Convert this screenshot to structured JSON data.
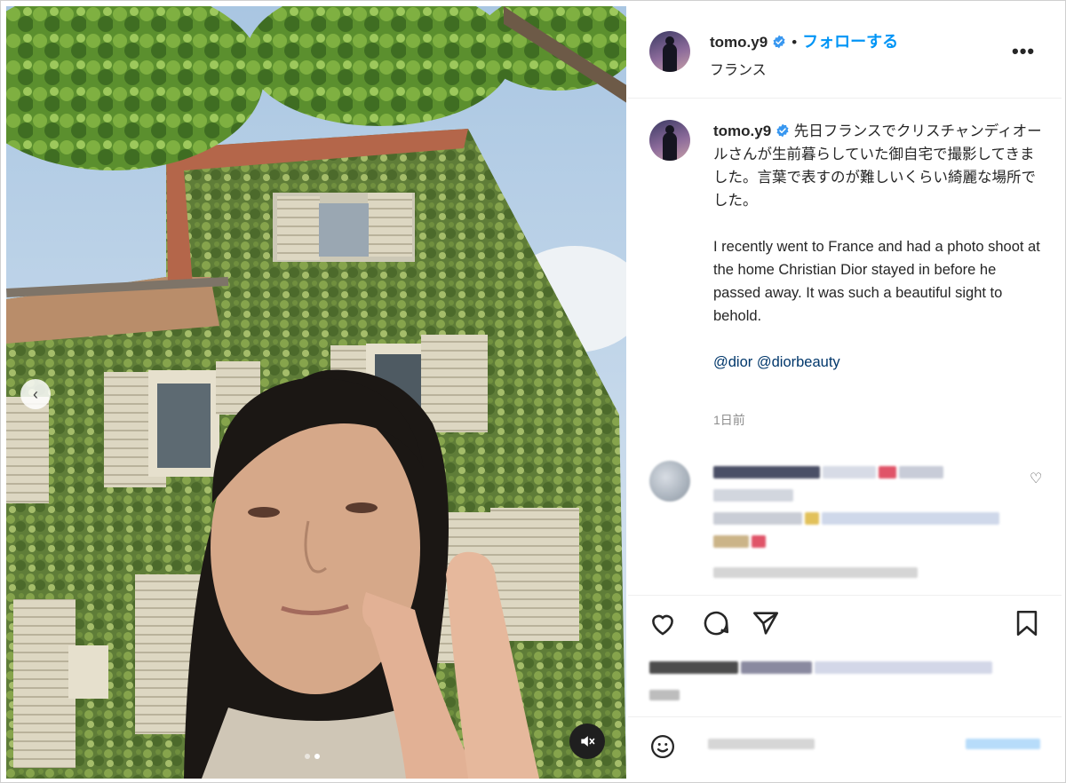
{
  "post": {
    "username": "tomo.y9",
    "separator": "•",
    "follow_label": "フォローする",
    "location": "フランス",
    "more_label": "•••"
  },
  "caption": {
    "username": "tomo.y9",
    "text_jp": "先日フランスでクリスチャンディオールさんが生前暮らしていた御自宅で撮影してきました。言葉で表すのが難しいくらい綺麗な場所でした。",
    "text_en": "I recently went to France and had a photo shoot at the home Christian Dior stayed in before he passed away. It was such a beautiful sight to behold.",
    "tag_1": "@dior",
    "tag_2": "@diorbeauty",
    "time": "1日前"
  },
  "media": {
    "prev_glyph": "‹",
    "slide_count": 2,
    "active_slide": 2
  },
  "icons": {
    "like": "heart-icon",
    "comment": "comment-icon",
    "share": "share-icon",
    "save": "bookmark-icon",
    "emoji": "emoji-icon",
    "mute": "speaker-muted-icon",
    "verified": "verified-badge-icon"
  },
  "colors": {
    "accent": "#0095f6",
    "verified": "#3897f0",
    "mention": "#00376b",
    "muted_text": "#8e8e8e"
  }
}
